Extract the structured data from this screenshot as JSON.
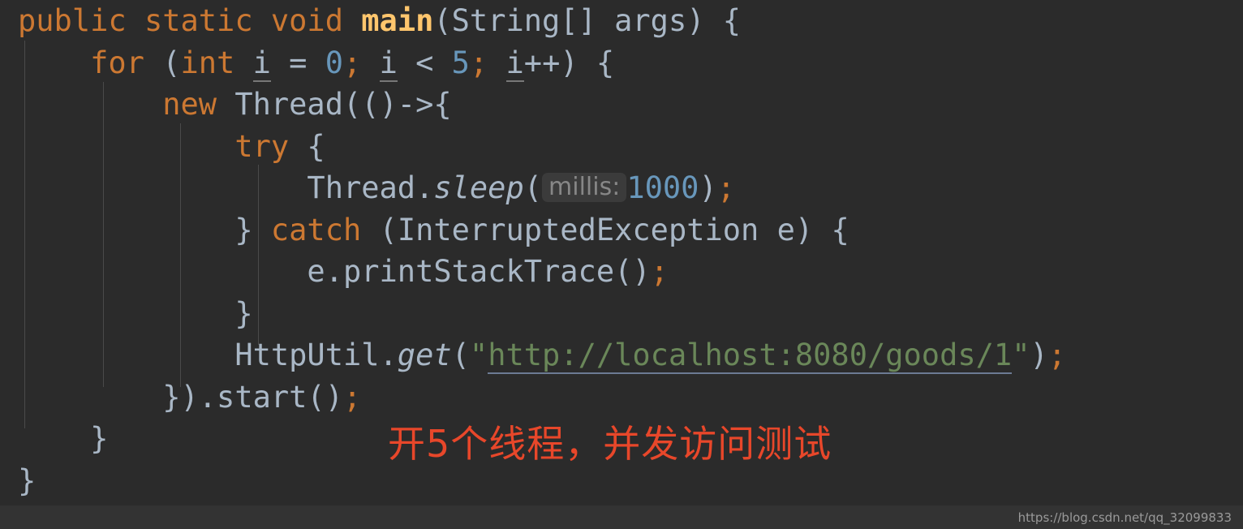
{
  "editor": {
    "background_color": "#2b2b2b",
    "default_text_color": "#a9b7c6",
    "keyword_color": "#cc7832",
    "method_color": "#ffc66d",
    "number_color": "#6897bb",
    "string_color": "#6a8759",
    "hint_badge_bg": "#3b3b3b",
    "hint_badge_color": "#878787",
    "indent_guide_color": "#4a4a4a"
  },
  "code": {
    "language": "java",
    "line1": {
      "kw_public": "public",
      "sp1": " ",
      "kw_static": "static",
      "sp2": " ",
      "kw_void": "void",
      "sp3": " ",
      "method_main": "main",
      "params": "(String[] args) {"
    },
    "line2": {
      "indent": "    ",
      "kw_for": "for",
      "open": " (",
      "kw_int": "int",
      "sp": " ",
      "var_i1": "i",
      "eq": " = ",
      "num_0": "0",
      "semi1": ";",
      "sp2": " ",
      "var_i2": "i",
      "lt": " < ",
      "num_5": "5",
      "semi2": ";",
      "sp3": " ",
      "var_i3": "i",
      "tail": "++) {"
    },
    "line3": {
      "indent": "        ",
      "kw_new": "new",
      "rest": " Thread(()->{"
    },
    "line4": {
      "indent": "            ",
      "kw_try": "try",
      "rest": " {"
    },
    "line5": {
      "indent": "                ",
      "cls": "Thread.",
      "method_sleep": "sleep",
      "open_paren": "(",
      "param_hint": "millis:",
      "num_1000": "1000",
      "close_paren": ")",
      "semi": ";"
    },
    "line6": {
      "indent": "            ",
      "brace": "} ",
      "kw_catch": "catch",
      "rest": " (InterruptedException e) {"
    },
    "line7": {
      "indent": "                ",
      "call": "e.printStackTrace()",
      "semi": ";"
    },
    "line8": {
      "indent": "            ",
      "brace": "}"
    },
    "line9": {
      "indent": "            ",
      "cls": "HttpUtil.",
      "method_get": "get",
      "open": "(",
      "quote_open": "\"",
      "url": "http://localhost:8080/goods/1",
      "quote_close": "\"",
      "close": ")",
      "semi": ";"
    },
    "line10": {
      "indent": "        ",
      "text": "}).start()",
      "semi": ";"
    },
    "line11": {
      "indent": "    ",
      "brace": "}"
    },
    "line12": {
      "indent": "",
      "brace": "}"
    }
  },
  "annotation": {
    "text": "开5个线程，并发访问测试",
    "color": "#e8472a"
  },
  "status_bar": {
    "watermark": "https://blog.csdn.net/qq_32099833"
  }
}
